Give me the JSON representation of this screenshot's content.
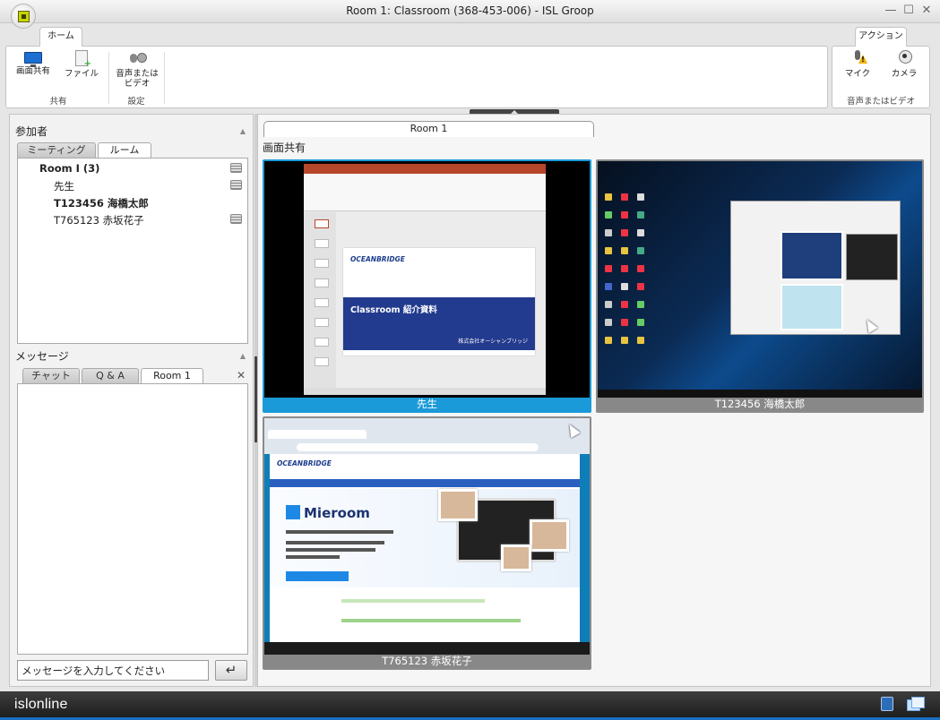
{
  "window": {
    "title": "Room 1: Classroom (368-453-006) - ISL Groop",
    "minimize": "—",
    "maximize": "☐",
    "close": "✕"
  },
  "ribbon": {
    "tabs": {
      "home": "ホーム",
      "action": "アクション"
    },
    "share_group": {
      "label": "共有",
      "screen_share": "画面共有",
      "file": "ファイル"
    },
    "settings_group": {
      "label": "設定",
      "audio_video": "音声または ビデオ"
    },
    "av_group": {
      "label": "音声またはビデオ",
      "mic": "マイク",
      "camera": "カメラ"
    }
  },
  "participants": {
    "title": "参加者",
    "tabs": [
      "ミーティング",
      "ルーム"
    ],
    "room": "Room I (3)",
    "members": [
      {
        "name": "先生"
      },
      {
        "name": "T123456 海橋太郎"
      },
      {
        "name": "T765123 赤坂花子"
      }
    ]
  },
  "messages": {
    "title": "メッセージ",
    "tabs": [
      "チャット",
      "Q & A",
      "Room 1"
    ],
    "input_placeholder": "メッセージを入力してください",
    "send_icon": "↵"
  },
  "main": {
    "room_tab": "Room 1",
    "section_label": "画面共有",
    "tiles": [
      {
        "caption": "先生",
        "active": true
      },
      {
        "caption": "T123456 海橋太郎",
        "active": false
      },
      {
        "caption": "T765123 赤坂花子",
        "active": false
      }
    ],
    "slide": {
      "logo": "OCEANBRIDGE",
      "title": "Classroom 紹介資料",
      "footer": "株式会社オーシャンブリッジ"
    },
    "browser": {
      "logo": "OCEANBRIDGE",
      "brand": "Mieroom"
    }
  },
  "footer": {
    "brand": "islonline"
  },
  "colors": {
    "active_tile": "#1a9ad8",
    "inactive_tile": "#8b8b8b",
    "slide_band": "#223b8e"
  }
}
